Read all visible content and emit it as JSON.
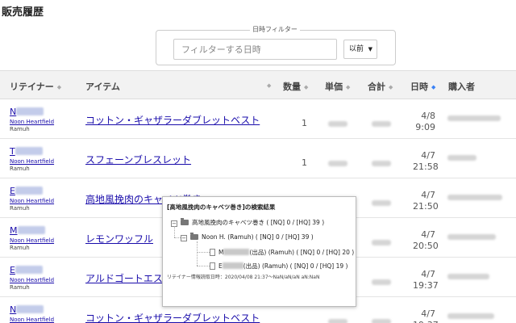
{
  "page": {
    "title": "販売履歴"
  },
  "filter": {
    "legend": "日時フィルター",
    "placeholder": "フィルターする日時",
    "direction": "以前"
  },
  "table": {
    "columns": {
      "retainer": "リテイナー",
      "item": "アイテム",
      "qty": "数量",
      "unit_price": "単価",
      "total": "合計",
      "date": "日時",
      "buyer": "購入者"
    },
    "sorted_column": "date",
    "rows": [
      {
        "retainer_initial": "N",
        "world": "Noon Heartfield",
        "dc": "Ramuh",
        "item": "コットン・ギャザラーダブレットベスト",
        "qty": "1",
        "date": "4/8",
        "time": "9:09"
      },
      {
        "retainer_initial": "T",
        "world": "Noon Heartfield",
        "dc": "Ramuh",
        "item": "スフェーンブレスレット",
        "qty": "1",
        "date": "4/7",
        "time": "21:58"
      },
      {
        "retainer_initial": "E",
        "world": "Noon Heartfield",
        "dc": "Ramuh",
        "item": "高地風挽肉のキャベツ巻き",
        "qty": "",
        "date": "4/7",
        "time": "21:50"
      },
      {
        "retainer_initial": "M",
        "world": "Noon Heartfield",
        "dc": "Ramuh",
        "item": "レモンワッフル",
        "qty": "",
        "date": "4/7",
        "time": "20:50"
      },
      {
        "retainer_initial": "E",
        "world": "Noon Heartfield",
        "dc": "Ramuh",
        "item": "アルドゴートエスパ",
        "qty": "",
        "date": "4/7",
        "time": "19:37"
      },
      {
        "retainer_initial": "N",
        "world": "Noon Heartfield",
        "dc": "",
        "item": "コットン・ギャザラーダブレットベスト",
        "qty": "",
        "date": "4/7",
        "time": "19:37"
      }
    ]
  },
  "popup": {
    "title": "[高地風挽肉のキャベツ巻き]の検索結果",
    "root": "高地風挽肉のキャベツ巻き ( [NQ] 0 / [HQ] 39 )",
    "child": "Noon H. (Ramuh) ( [NQ] 0 / [HQ] 39 )",
    "leaf1_prefix": "M",
    "leaf1_suffix": "(出品) (Ramuh) ( [NQ] 0 / [HQ] 20 )",
    "leaf2_prefix": "E",
    "leaf2_suffix": "(出品) (Ramuh) ( [NQ] 0 / [HQ] 19 )",
    "footer": "リテイナー情報読取日時：2020/04/08 21:37～NaN/aN/aN aN:NaN"
  },
  "icons": {
    "sort": "sort-icon",
    "sort_active": "sort-desc-icon",
    "folder": "folder-icon",
    "file": "file-icon",
    "caret": "caret-down-icon"
  },
  "colors": {
    "link": "#1a0dab",
    "header_bg": "#f2f2f2",
    "sort_active": "#3b82f6"
  }
}
